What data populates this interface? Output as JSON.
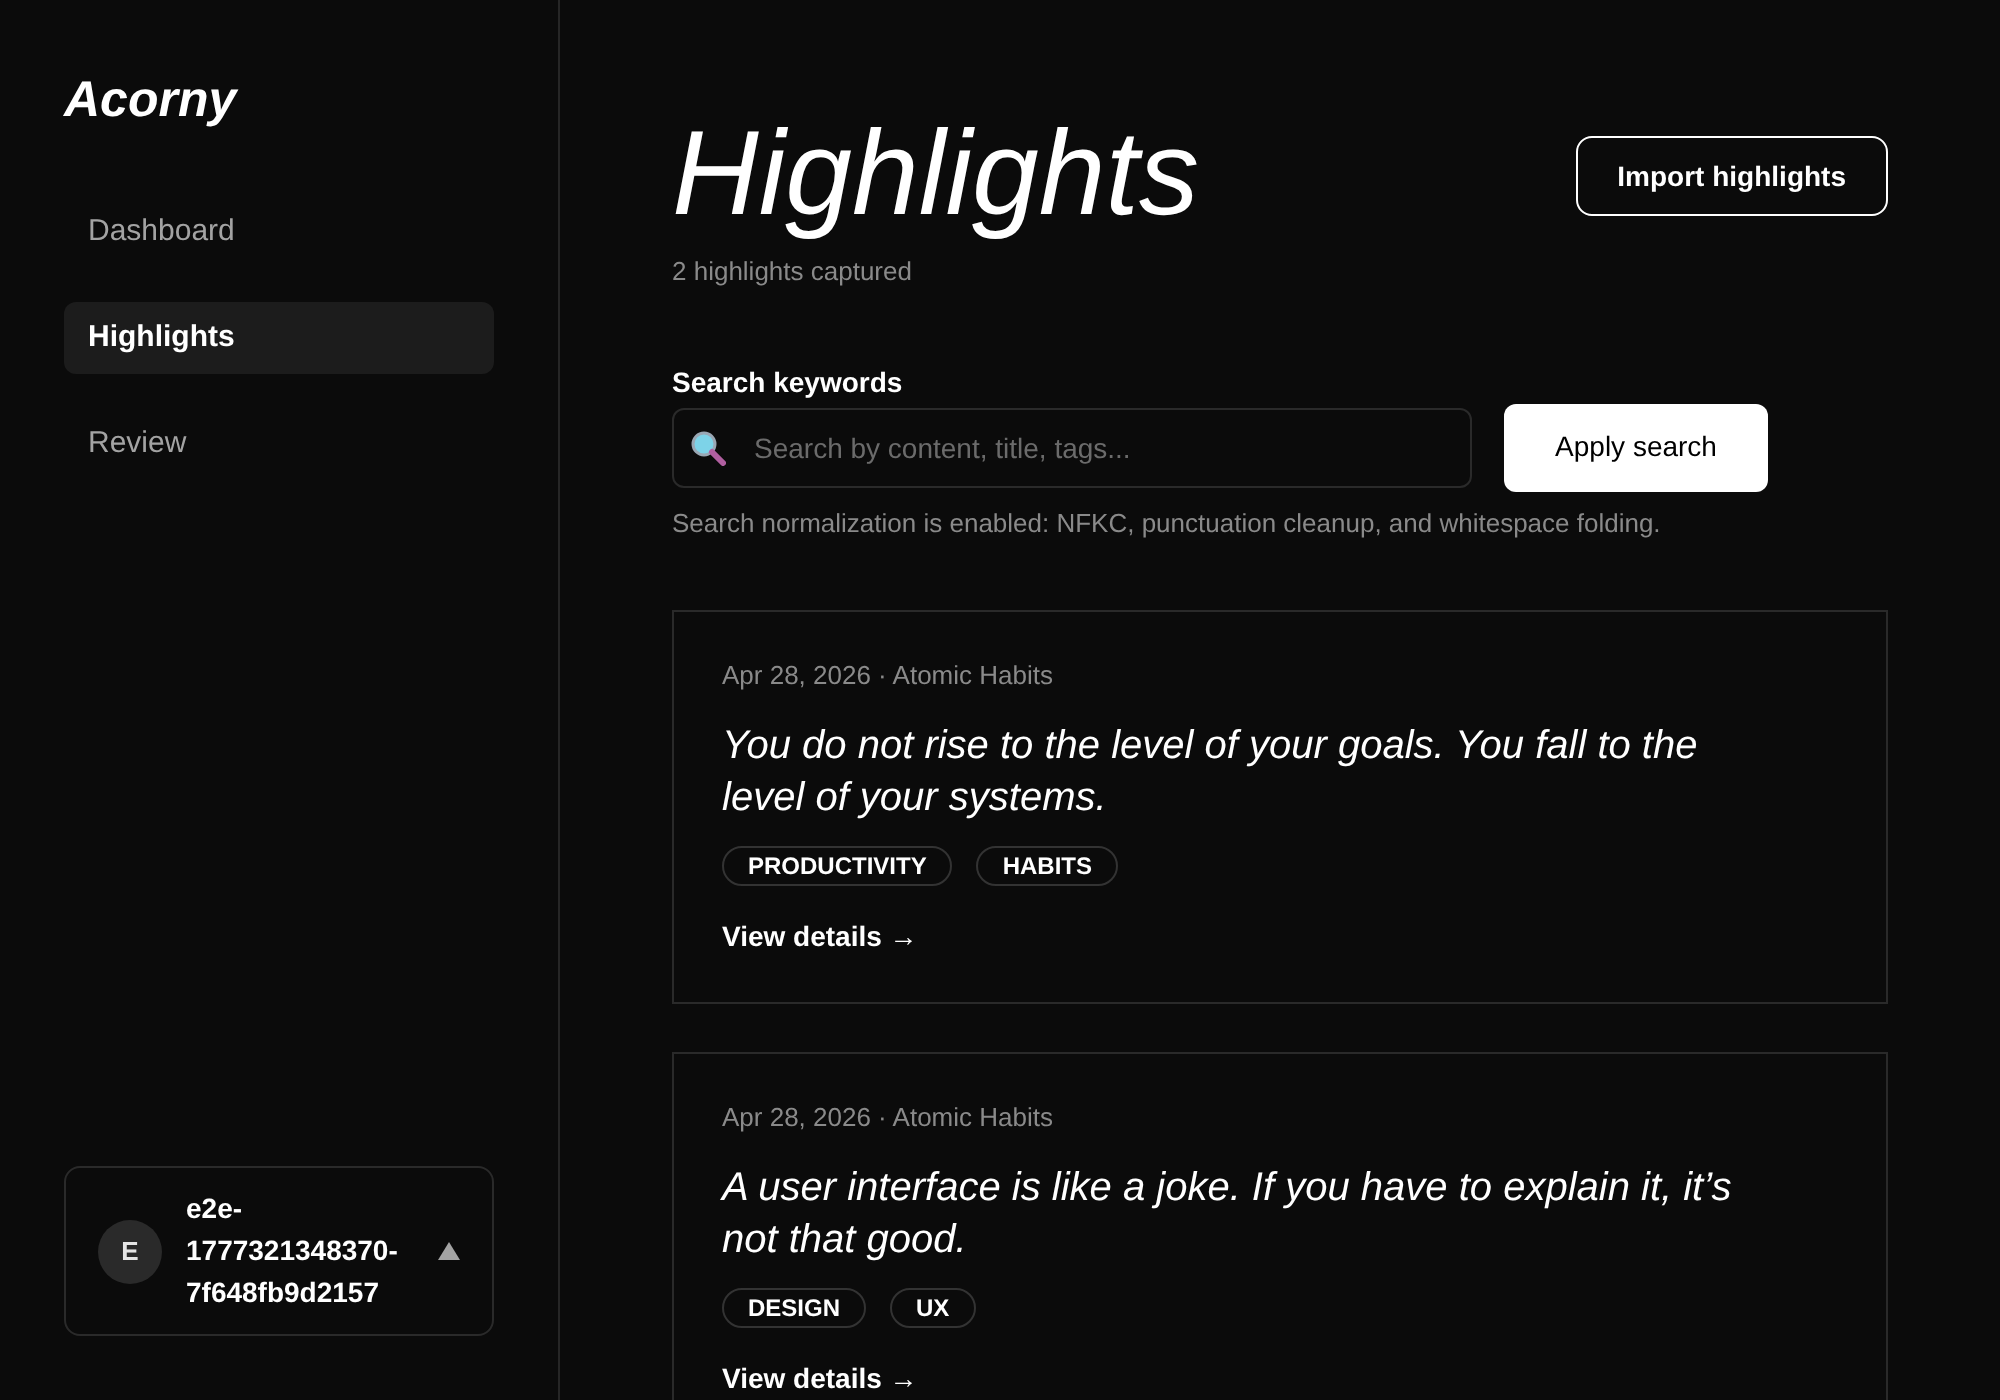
{
  "sidebar": {
    "logo": "Acorny",
    "nav": [
      {
        "label": "Dashboard",
        "selected": false
      },
      {
        "label": "Highlights",
        "selected": true
      },
      {
        "label": "Review",
        "selected": false
      }
    ],
    "account": {
      "avatar": "E",
      "name": "e2e-1777321348370-7f648fb9d2157"
    }
  },
  "header": {
    "title": "Highlights",
    "subtitle": "2 highlights captured",
    "import_button": "Import highlights"
  },
  "search": {
    "label": "Search keywords",
    "placeholder": "Search by content, title, tags...",
    "button": "Apply search",
    "note": "Search normalization is enabled: NFKC, punctuation cleanup, and whitespace folding."
  },
  "highlights": [
    {
      "meta": "Apr 28, 2026 · Atomic Habits",
      "quote": "You do not rise to the level of your goals. You fall to the level of your systems.",
      "tags": [
        "PRODUCTIVITY",
        "HABITS"
      ],
      "link": "View details →"
    },
    {
      "meta": "Apr 28, 2026 · Atomic Habits",
      "quote": "A user interface is like a joke. If you have to explain it, it’s not that good.",
      "tags": [
        "DESIGN",
        "UX"
      ],
      "link": "View details →"
    }
  ]
}
